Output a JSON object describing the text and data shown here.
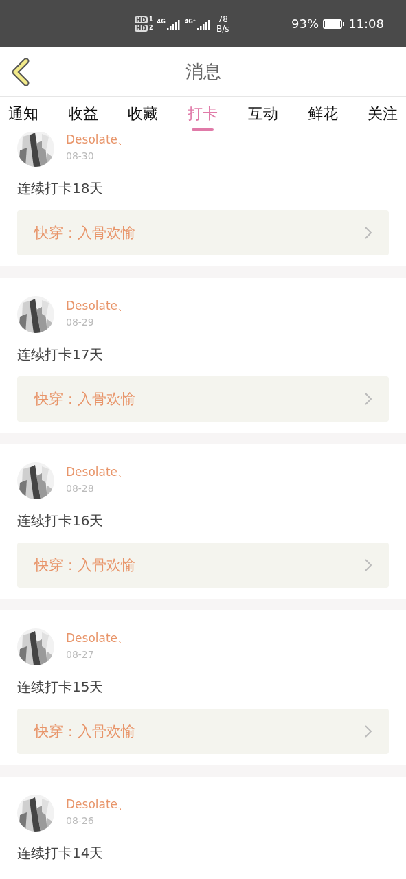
{
  "status_bar": {
    "sim1": "HD",
    "sim1_index": "1",
    "sim2": "HD",
    "sim2_index": "2",
    "net1": "4G",
    "net2": "4G⁺",
    "speed": "78",
    "speed_unit": "B/s",
    "battery": "93%",
    "time": "11:08"
  },
  "header": {
    "title": "消息"
  },
  "tabs": [
    {
      "label": "通知",
      "selected": false
    },
    {
      "label": "收益",
      "selected": false
    },
    {
      "label": "收藏",
      "selected": false
    },
    {
      "label": "打卡",
      "selected": true
    },
    {
      "label": "互动",
      "selected": false
    },
    {
      "label": "鲜花",
      "selected": false
    },
    {
      "label": "关注",
      "selected": false
    }
  ],
  "messages": [
    {
      "user": "Desolate、",
      "date": "08-30",
      "text": "连续打卡18天",
      "book": "快穿：入骨欢愉"
    },
    {
      "user": "Desolate、",
      "date": "08-29",
      "text": "连续打卡17天",
      "book": "快穿：入骨欢愉"
    },
    {
      "user": "Desolate、",
      "date": "08-28",
      "text": "连续打卡16天",
      "book": "快穿：入骨欢愉"
    },
    {
      "user": "Desolate、",
      "date": "08-27",
      "text": "连续打卡15天",
      "book": "快穿：入骨欢愉"
    },
    {
      "user": "Desolate、",
      "date": "08-26",
      "text": "连续打卡14天"
    }
  ]
}
